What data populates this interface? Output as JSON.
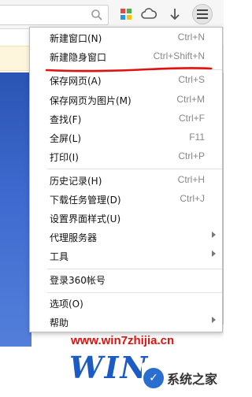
{
  "toolbar": {
    "search_icon": "search-icon",
    "apps_icon": "apps-grid-icon",
    "cloud_icon": "cloud-icon",
    "download_icon": "download-arrow-icon",
    "menu_icon": "hamburger-menu-icon"
  },
  "menu": {
    "items": [
      {
        "label": "新建窗口(N)",
        "shortcut": "Ctrl+N"
      },
      {
        "label": "新建隐身窗口",
        "shortcut": "Ctrl+Shift+N"
      },
      {
        "label": "保存网页(A)",
        "shortcut": "Ctrl+S"
      },
      {
        "label": "保存网页为图片(M)",
        "shortcut": "Ctrl+M"
      },
      {
        "label": "查找(F)",
        "shortcut": "Ctrl+F"
      },
      {
        "label": "全屏(L)",
        "shortcut": "F11"
      },
      {
        "label": "打印(I)",
        "shortcut": "Ctrl+P"
      },
      {
        "label": "历史记录(H)",
        "shortcut": "Ctrl+H"
      },
      {
        "label": "下载任务管理(D)",
        "shortcut": "Ctrl+J"
      },
      {
        "label": "设置界面样式(U)",
        "shortcut": ""
      },
      {
        "label": "代理服务器",
        "shortcut": ""
      },
      {
        "label": "工具",
        "shortcut": ""
      },
      {
        "label": "登录360帐号",
        "shortcut": ""
      },
      {
        "label": "选项(O)",
        "shortcut": ""
      },
      {
        "label": "帮助",
        "shortcut": ""
      }
    ]
  },
  "watermark": {
    "url": "www.win7zhijia.cn",
    "logo_text": "WIN",
    "badge_text": "系统之家"
  },
  "colors": {
    "underline": "#e0120f",
    "watermark": "#e0120f",
    "logo": "#1d5bc4"
  }
}
